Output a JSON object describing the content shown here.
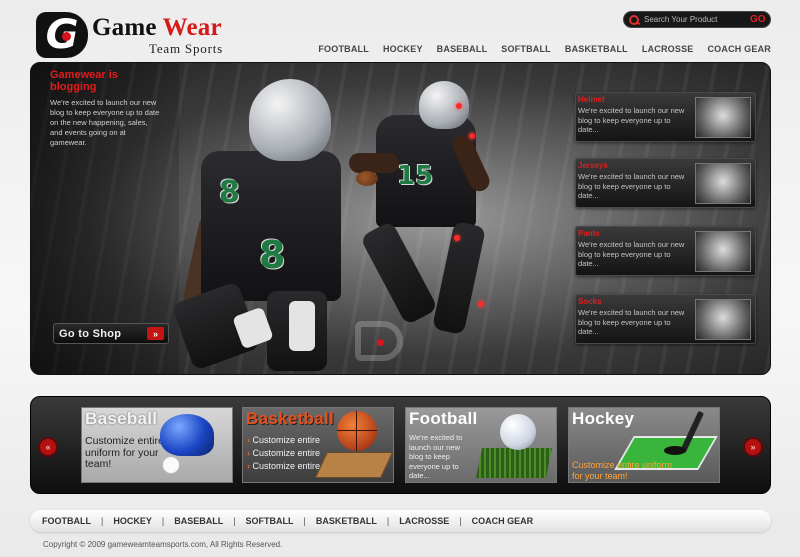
{
  "brand": {
    "name_part1": "Game",
    "name_part2": "Wear",
    "tagline": "Team Sports",
    "logo_letter": "G"
  },
  "search": {
    "placeholder": "Search Your Product",
    "go_label": "GO"
  },
  "top_nav": [
    "FOOTBALL",
    "HOCKEY",
    "BASEBALL",
    "SOFTBALL",
    "BASKETBALL",
    "LACROSSE",
    "COACH GEAR"
  ],
  "hero": {
    "title": "Gamewear is blogging",
    "text": "We're excited to launch our new blog to keep everyone up to date on the new happening, sales, and events going on at gamewear.",
    "shop_button": "Go to Shop",
    "shop_button_arrow": "»",
    "jersey_number_left": "8",
    "jersey_number_right": "15",
    "cards": [
      {
        "title": "Helmet",
        "text": "We're excited to launch our new blog to keep everyone up to date..."
      },
      {
        "title": "Jerseys",
        "text": "We're excited to launch our new blog to keep everyone up to date..."
      },
      {
        "title": "Pants",
        "text": "We're excited to launch our new blog to keep everyone up to date..."
      },
      {
        "title": "Socks",
        "text": "We're excited to launch our new blog to keep everyone up to date..."
      }
    ]
  },
  "categories": {
    "prev_label": "«",
    "next_label": "»",
    "baseball": {
      "name": "Baseball",
      "desc": "Customize entire uniform for your team!"
    },
    "basketball": {
      "name": "Basketball",
      "items": [
        "Customize entire",
        "Customize entire",
        "Customize entire"
      ]
    },
    "football": {
      "name": "Football",
      "desc": "We're excited to launch our new blog to keep everyone up to date..."
    },
    "hockey": {
      "name": "Hockey",
      "desc": "Customize entire uniform for your team!"
    }
  },
  "footer_nav": [
    "FOOTBALL",
    "HOCKEY",
    "BASEBALL",
    "SOFTBALL",
    "BASKETBALL",
    "LACROSSE",
    "COACH GEAR"
  ],
  "copyright": "Copyright © 2009 gameweamteamsports.com, All Rights Reserved.",
  "colors": {
    "accent": "#d41a1a",
    "dark": "#1a1a1a",
    "basketball_orange": "#e6501a"
  }
}
